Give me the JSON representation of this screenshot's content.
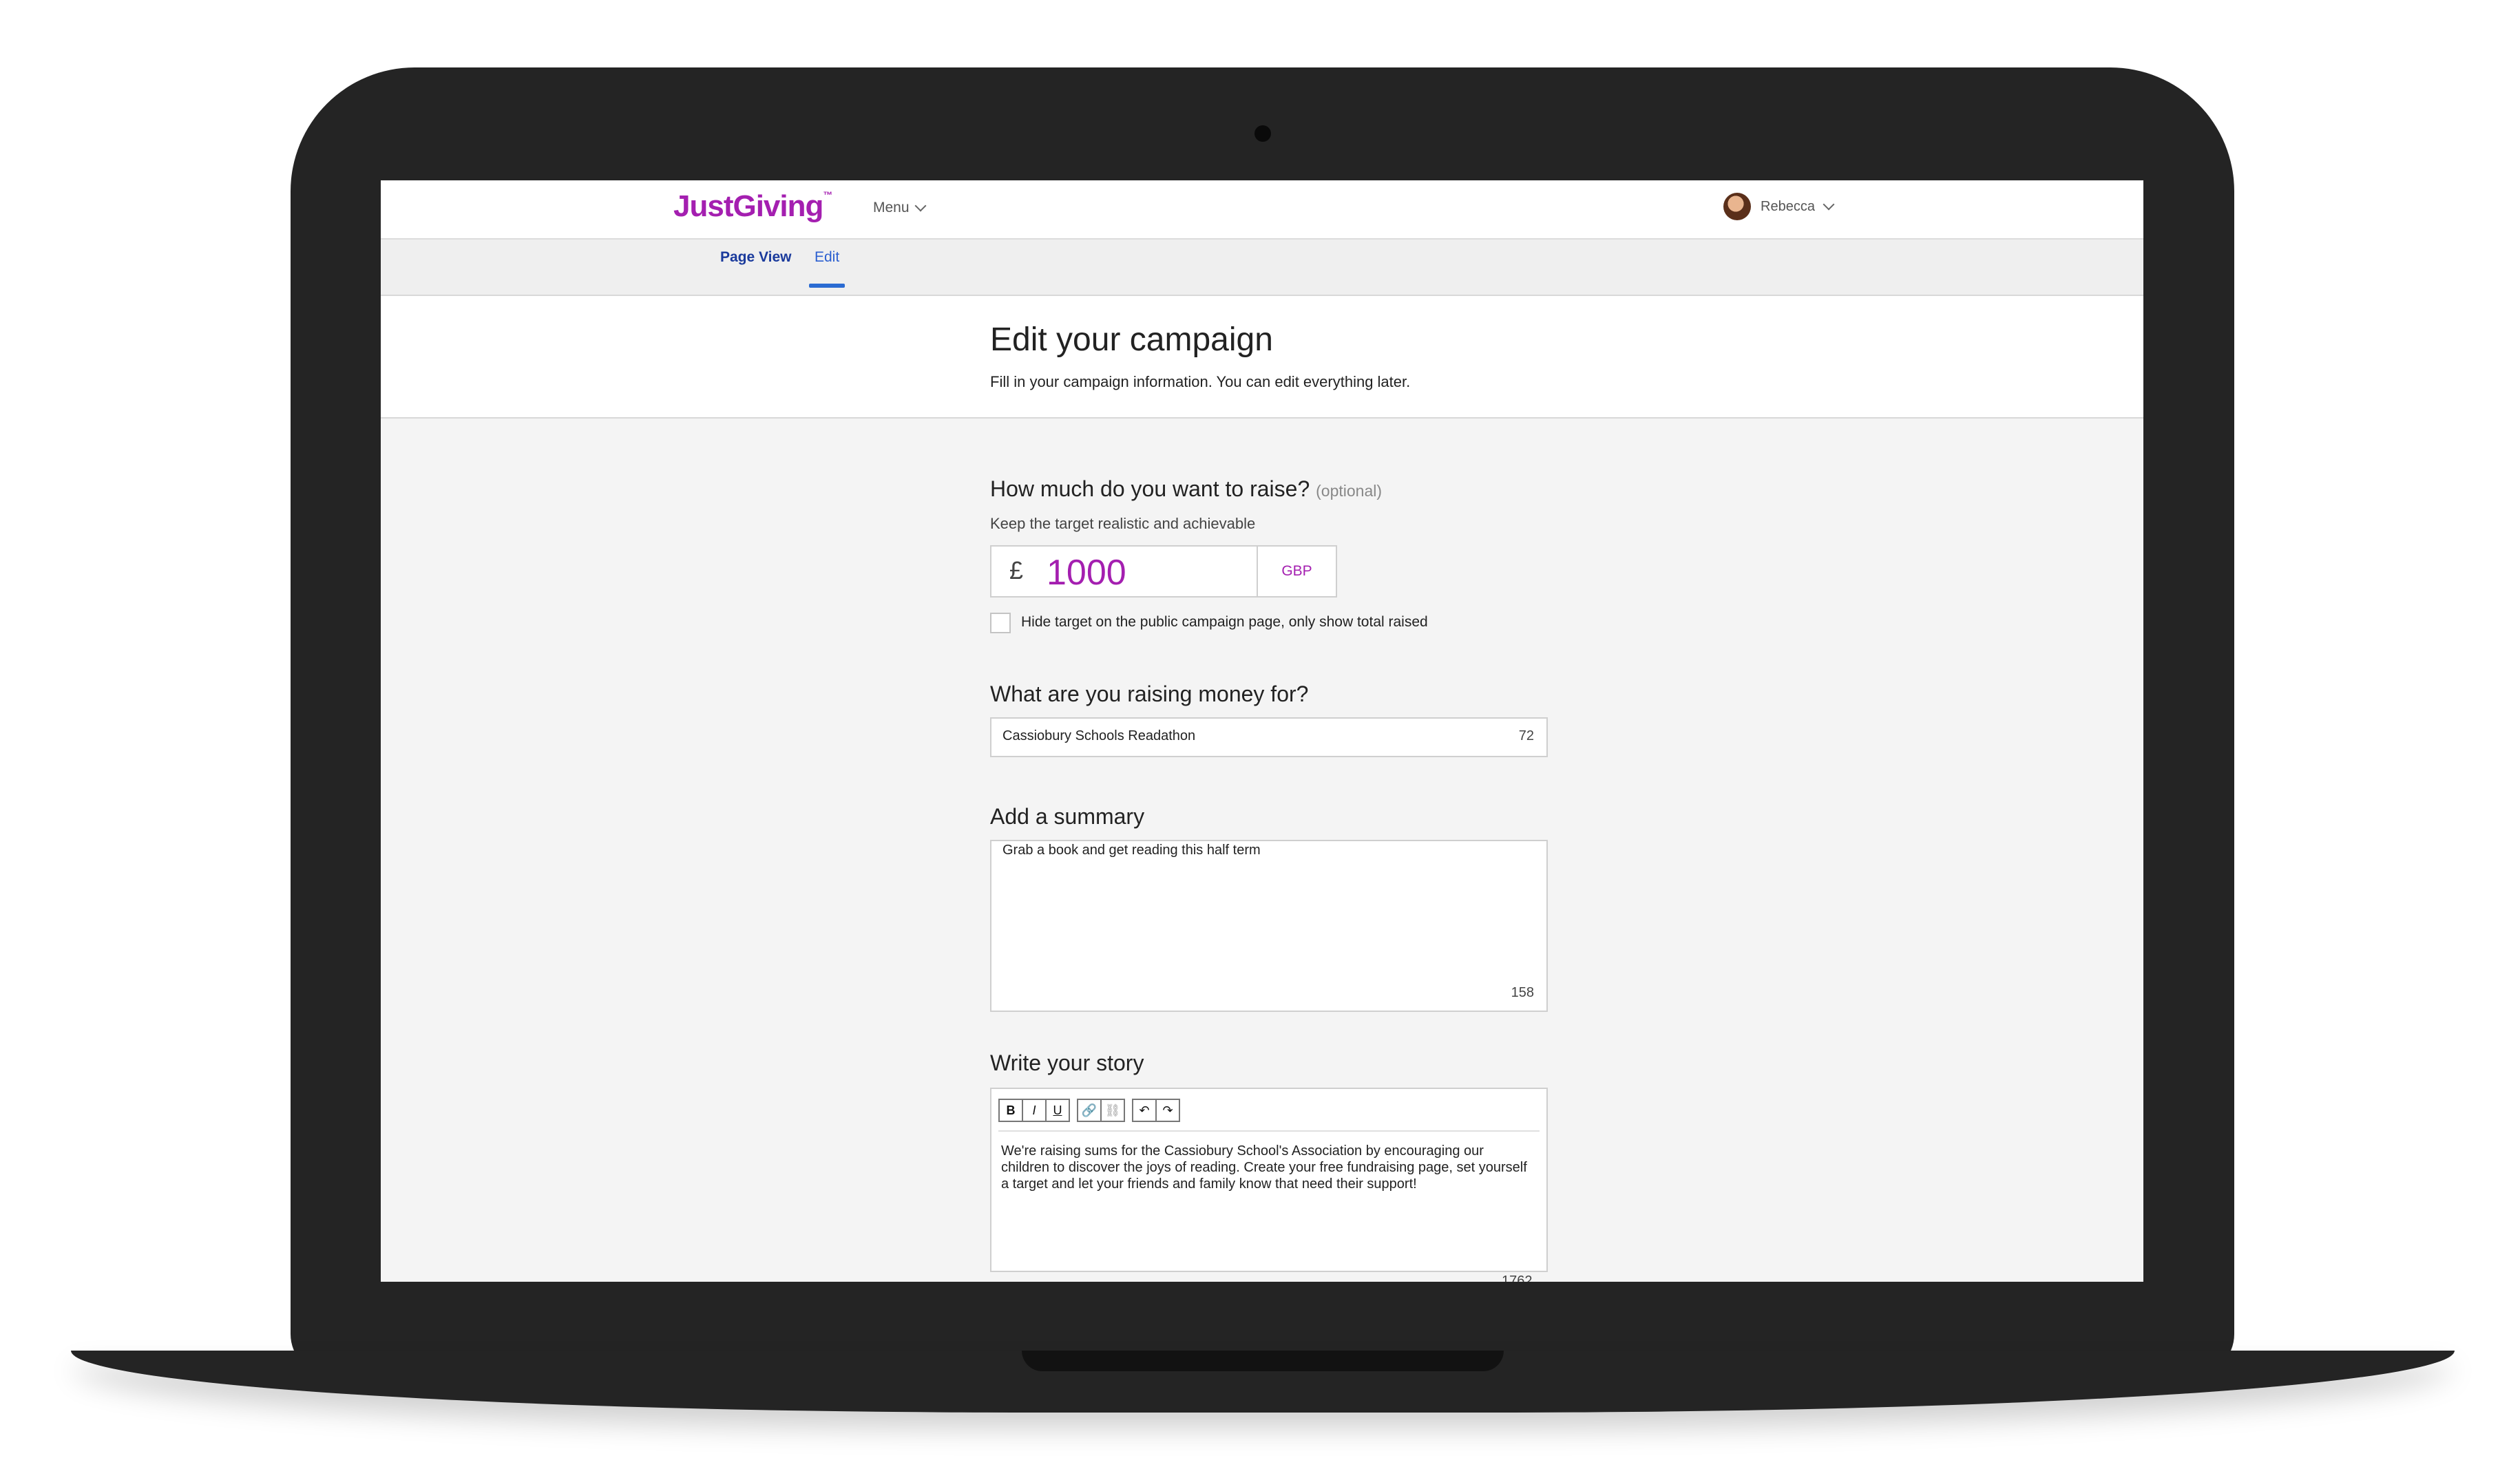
{
  "header": {
    "logo": "JustGiving",
    "logo_mark": "™",
    "menu_label": "Menu",
    "user_name": "Rebecca"
  },
  "tabs": [
    {
      "label": "Page View",
      "active": false
    },
    {
      "label": "Edit",
      "active": true
    }
  ],
  "hero": {
    "title": "Edit your campaign",
    "subtitle": "Fill in your campaign information. You can edit everything later."
  },
  "target": {
    "label": "How much do you want to raise?",
    "optional": "(optional)",
    "hint": "Keep the target realistic and achievable",
    "currency_symbol": "£",
    "amount": "1000",
    "currency_code": "GBP",
    "hide_checkbox_label": "Hide target on the public campaign page, only show total raised",
    "hide_checked": false
  },
  "purpose": {
    "label": "What are you raising money for?",
    "value": "Cassiobury Schools Readathon",
    "chars_left": "72"
  },
  "summary": {
    "label": "Add a summary",
    "value": "Grab a book and get reading this half term",
    "chars_left": "158"
  },
  "story": {
    "label": "Write your story",
    "toolbar": {
      "bold": "B",
      "italic": "I",
      "underline": "U",
      "link": "🔗",
      "unlink": "⛓",
      "undo": "↶",
      "redo": "↷"
    },
    "value": "We're raising sums for the Cassiobury School's Association by encouraging our children to discover the joys of reading. Create your free fundraising page, set yourself a target and let your friends and family know that need their support!",
    "chars_left": "1762"
  },
  "colors": {
    "brand": "#a41fb0",
    "tab_link": "#1a3a9c",
    "tab_underline": "#2b6bd2",
    "device": "#242424"
  }
}
